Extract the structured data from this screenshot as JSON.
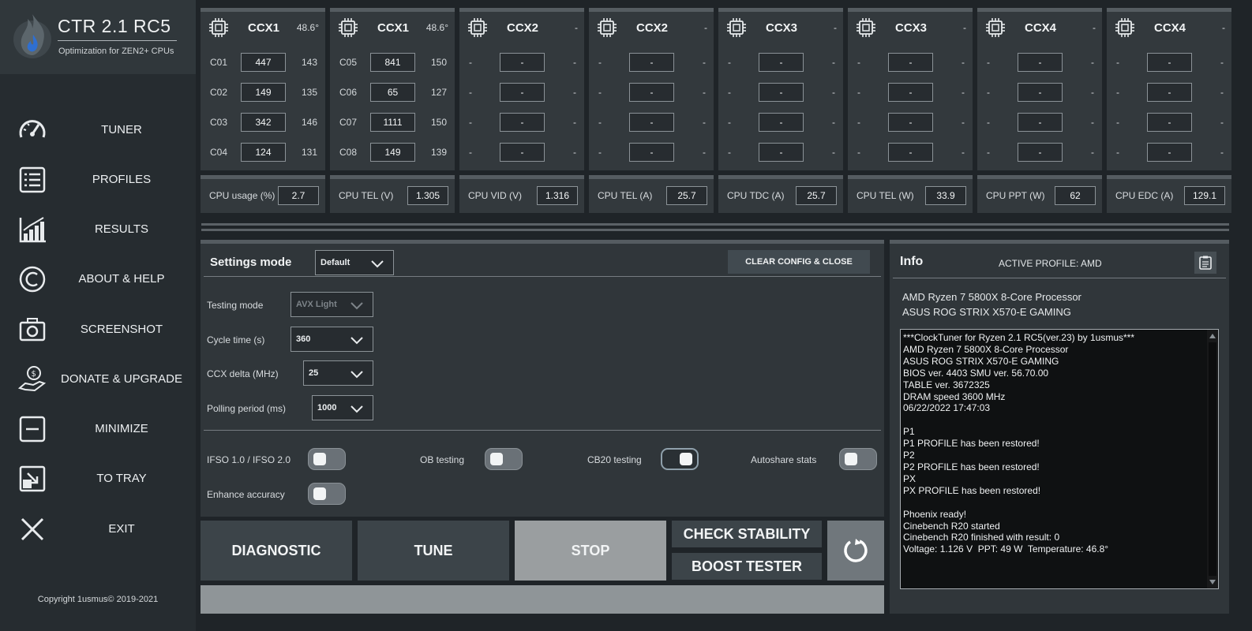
{
  "app": {
    "title": "CTR 2.1 RC5",
    "subtitle": "Optimization for ZEN2+ CPUs",
    "copyright": "Copyright 1usmus© 2019-2021"
  },
  "nav": [
    {
      "label": "TUNER",
      "icon": "speedometer-icon"
    },
    {
      "label": "PROFILES",
      "icon": "list-icon"
    },
    {
      "label": "RESULTS",
      "icon": "bar-chart-icon"
    },
    {
      "label": "ABOUT & HELP",
      "icon": "copyright-icon"
    },
    {
      "label": "SCREENSHOT",
      "icon": "camera-icon"
    },
    {
      "label": "DONATE & UPGRADE",
      "icon": "donate-hand-icon"
    },
    {
      "label": "MINIMIZE",
      "icon": "minimize-icon"
    },
    {
      "label": "TO TRAY",
      "icon": "to-tray-icon"
    },
    {
      "label": "EXIT",
      "icon": "close-icon"
    }
  ],
  "ccx": [
    {
      "name": "CCX1",
      "temp": "48.6°",
      "cores": [
        {
          "label": "C01",
          "value": "447",
          "freq": "143"
        },
        {
          "label": "C02",
          "value": "149",
          "freq": "135"
        },
        {
          "label": "C03",
          "value": "342",
          "freq": "146"
        },
        {
          "label": "C04",
          "value": "124",
          "freq": "131"
        }
      ]
    },
    {
      "name": "CCX1",
      "temp": "48.6°",
      "cores": [
        {
          "label": "C05",
          "value": "841",
          "freq": "150"
        },
        {
          "label": "C06",
          "value": "65",
          "freq": "127"
        },
        {
          "label": "C07",
          "value": "1111",
          "freq": "150"
        },
        {
          "label": "C08",
          "value": "149",
          "freq": "139"
        }
      ]
    },
    {
      "name": "CCX2",
      "temp": "-",
      "cores": [
        {
          "label": "-",
          "value": "-",
          "freq": "-"
        },
        {
          "label": "-",
          "value": "-",
          "freq": "-"
        },
        {
          "label": "-",
          "value": "-",
          "freq": "-"
        },
        {
          "label": "-",
          "value": "-",
          "freq": "-"
        }
      ]
    },
    {
      "name": "CCX2",
      "temp": "-",
      "cores": [
        {
          "label": "-",
          "value": "-",
          "freq": "-"
        },
        {
          "label": "-",
          "value": "-",
          "freq": "-"
        },
        {
          "label": "-",
          "value": "-",
          "freq": "-"
        },
        {
          "label": "-",
          "value": "-",
          "freq": "-"
        }
      ]
    },
    {
      "name": "CCX3",
      "temp": "-",
      "cores": [
        {
          "label": "-",
          "value": "-",
          "freq": "-"
        },
        {
          "label": "-",
          "value": "-",
          "freq": "-"
        },
        {
          "label": "-",
          "value": "-",
          "freq": "-"
        },
        {
          "label": "-",
          "value": "-",
          "freq": "-"
        }
      ]
    },
    {
      "name": "CCX3",
      "temp": "-",
      "cores": [
        {
          "label": "-",
          "value": "-",
          "freq": "-"
        },
        {
          "label": "-",
          "value": "-",
          "freq": "-"
        },
        {
          "label": "-",
          "value": "-",
          "freq": "-"
        },
        {
          "label": "-",
          "value": "-",
          "freq": "-"
        }
      ]
    },
    {
      "name": "CCX4",
      "temp": "-",
      "cores": [
        {
          "label": "-",
          "value": "-",
          "freq": "-"
        },
        {
          "label": "-",
          "value": "-",
          "freq": "-"
        },
        {
          "label": "-",
          "value": "-",
          "freq": "-"
        },
        {
          "label": "-",
          "value": "-",
          "freq": "-"
        }
      ]
    },
    {
      "name": "CCX4",
      "temp": "-",
      "cores": [
        {
          "label": "-",
          "value": "-",
          "freq": "-"
        },
        {
          "label": "-",
          "value": "-",
          "freq": "-"
        },
        {
          "label": "-",
          "value": "-",
          "freq": "-"
        },
        {
          "label": "-",
          "value": "-",
          "freq": "-"
        }
      ]
    }
  ],
  "stats": [
    {
      "label": "CPU usage (%)",
      "value": "2.7"
    },
    {
      "label": "CPU TEL (V)",
      "value": "1.305"
    },
    {
      "label": "CPU VID (V)",
      "value": "1.316"
    },
    {
      "label": "CPU TEL (A)",
      "value": "25.7"
    },
    {
      "label": "CPU TDC (A)",
      "value": "25.7"
    },
    {
      "label": "CPU TEL (W)",
      "value": "33.9"
    },
    {
      "label": "CPU PPT (W)",
      "value": "62"
    },
    {
      "label": "CPU EDC (A)",
      "value": "129.1"
    }
  ],
  "settings": {
    "title": "Settings mode",
    "mode": "Default",
    "clear_label": "CLEAR CONFIG & CLOSE",
    "testing_mode_label": "Testing mode",
    "testing_mode": "AVX Light",
    "cycle_label": "Cycle time (s)",
    "cycle": "360",
    "delta_label": "CCX delta (MHz)",
    "delta": "25",
    "polling_label": "Polling period (ms)",
    "polling": "1000",
    "ifso_label": "IFSO 1.0 / IFSO 2.0",
    "ob_label": "OB testing",
    "cb20_label": "CB20 testing",
    "autoshare_label": "Autoshare stats",
    "enhance_label": "Enhance accuracy"
  },
  "buttons": {
    "diagnostic": "DIAGNOSTIC",
    "tune": "TUNE",
    "stop": "STOP",
    "check": "CHECK STABILITY",
    "boost": "BOOST TESTER"
  },
  "info": {
    "title": "Info",
    "active_profile": "ACTIVE PROFILE: AMD",
    "cpu": "AMD Ryzen 7 5800X 8-Core Processor",
    "board": "ASUS ROG STRIX X570-E GAMING",
    "log": [
      "***ClockTuner for Ryzen 2.1 RC5(ver.23) by 1usmus***",
      "AMD Ryzen 7 5800X 8-Core Processor",
      "ASUS ROG STRIX X570-E GAMING",
      "BIOS ver. 4403 SMU ver. 56.70.00",
      "TABLE ver. 3672325",
      "DRAM speed 3600 MHz",
      "06/22/2022 17:47:03",
      "",
      "P1",
      "P1 PROFILE has been restored!",
      "P2",
      "P2 PROFILE has been restored!",
      "PX",
      "PX PROFILE has been restored!",
      "",
      "Phoenix ready!",
      "Cinebench R20 started",
      "Cinebench R20 finished with result: 0",
      "Voltage: 1.126 V  PPT: 49 W  Temperature: 46.8°"
    ]
  }
}
